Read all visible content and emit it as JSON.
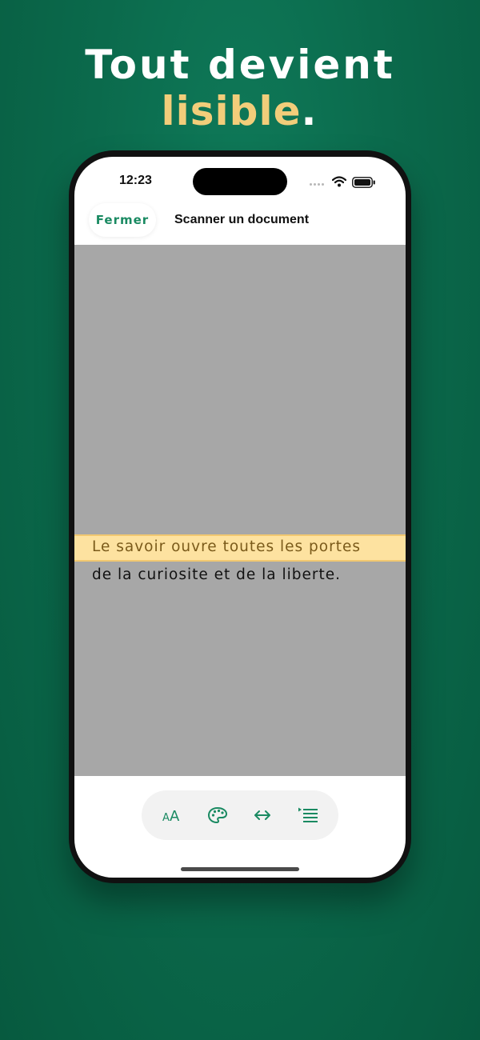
{
  "headline": {
    "line1": "Tout devient",
    "accent": "lisible",
    "period": "."
  },
  "status_bar": {
    "time": "12:23"
  },
  "nav": {
    "close_label": "Fermer",
    "title": "Scanner un document"
  },
  "document": {
    "lines": [
      "Le savoir ouvre toutes les portes",
      "de la curiosite et de la liberte."
    ],
    "highlighted_line": 0
  },
  "toolbar": {
    "text_size_label": "AA",
    "icons": [
      "text-size-icon",
      "palette-icon",
      "width-arrows-icon",
      "line-spacing-icon"
    ]
  },
  "colors": {
    "background": "#0b6a4c",
    "accent_gold": "#f2cd7a",
    "brand_green": "#1a8a62",
    "highlight": "#fde2a0",
    "document_gray": "#a7a7a7"
  }
}
